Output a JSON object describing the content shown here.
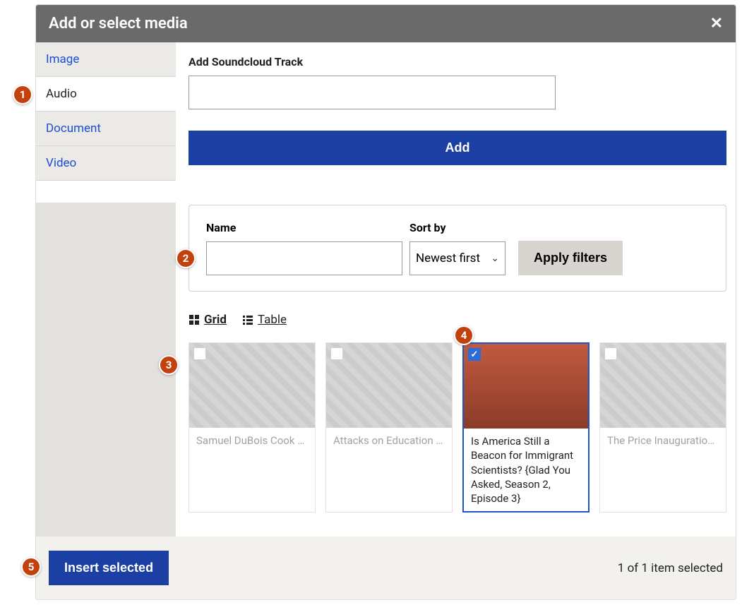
{
  "modal": {
    "title": "Add or select media",
    "close_aria": "Close"
  },
  "tabs": {
    "image": "Image",
    "audio": "Audio",
    "document": "Document",
    "video": "Video"
  },
  "soundcloud": {
    "label": "Add Soundcloud Track",
    "value": "",
    "add_label": "Add"
  },
  "filters": {
    "name_label": "Name",
    "name_value": "",
    "sort_label": "Sort by",
    "sort_value": "Newest first",
    "apply_label": "Apply filters"
  },
  "view": {
    "grid_label": "Grid",
    "table_label": "Table"
  },
  "cards": [
    {
      "title": "Samuel DuBois Cook A…",
      "selected": false
    },
    {
      "title": "Attacks on Education H…",
      "selected": false
    },
    {
      "title": "Is America Still a Beacon for Immigrant Scientists? {Glad You Asked, Season 2, Episode 3}",
      "selected": true
    },
    {
      "title": "The Price Inauguration,…",
      "selected": false
    }
  ],
  "footer": {
    "insert_label": "Insert selected",
    "status": "1 of 1 item selected"
  },
  "annotations": {
    "b1": "1",
    "b2": "2",
    "b3": "3",
    "b4": "4",
    "b5": "5"
  }
}
